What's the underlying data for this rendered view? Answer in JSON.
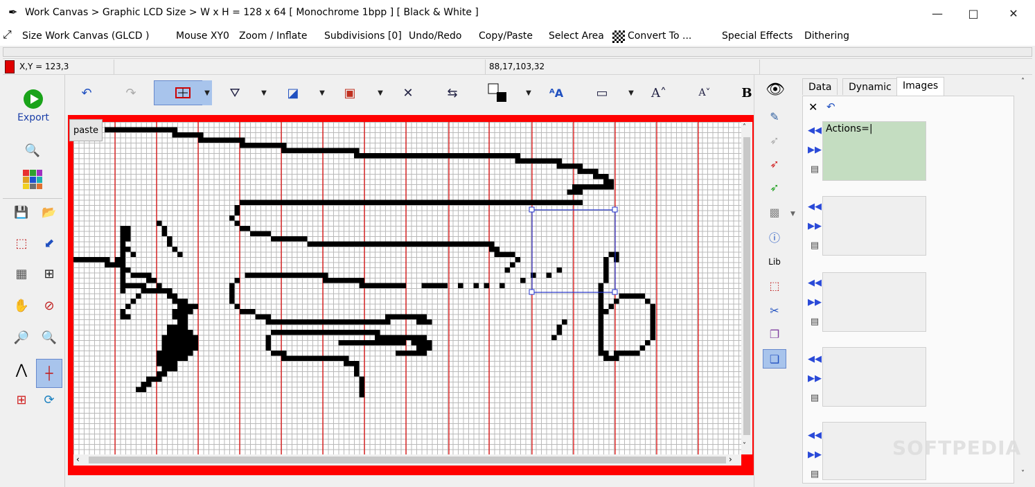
{
  "window": {
    "title": "Work Canvas > Graphic LCD Size > W x H = 128 x 64 [ Monochrome 1bpp ] [ Black & White ]",
    "app_icon": "pen-icon",
    "controls": [
      "minimize",
      "maximize",
      "close"
    ]
  },
  "menubar": {
    "items": [
      {
        "label": "Size Work Canvas (GLCD )",
        "icon": "resize-arrows-icon"
      },
      {
        "label": "Mouse XY0"
      },
      {
        "label": "Zoom / Inflate"
      },
      {
        "label": "Subdivisions [0]"
      },
      {
        "label": "Undo/Redo"
      },
      {
        "label": "Copy/Paste"
      },
      {
        "label": "Select Area"
      },
      {
        "label": "Convert To ...",
        "icon": "checkers-icon"
      },
      {
        "label": "Special Effects"
      },
      {
        "label": "Dithering"
      }
    ]
  },
  "statusbar": {
    "xy": "X,Y = 123,3",
    "selection": "88,17,103,32",
    "color_swatch": "#e00000"
  },
  "left_panel": {
    "export_label": "Export"
  },
  "canvas": {
    "paste_label": "paste",
    "frame_color": "#ff0000",
    "grid_divider_color": "#e00000"
  },
  "tabs": {
    "items": [
      "Data",
      "Dynamic",
      "Images"
    ],
    "active": "Images"
  },
  "image_slots": {
    "actions_text": "Actions=|"
  },
  "watermark": "SOFTPEDIA"
}
